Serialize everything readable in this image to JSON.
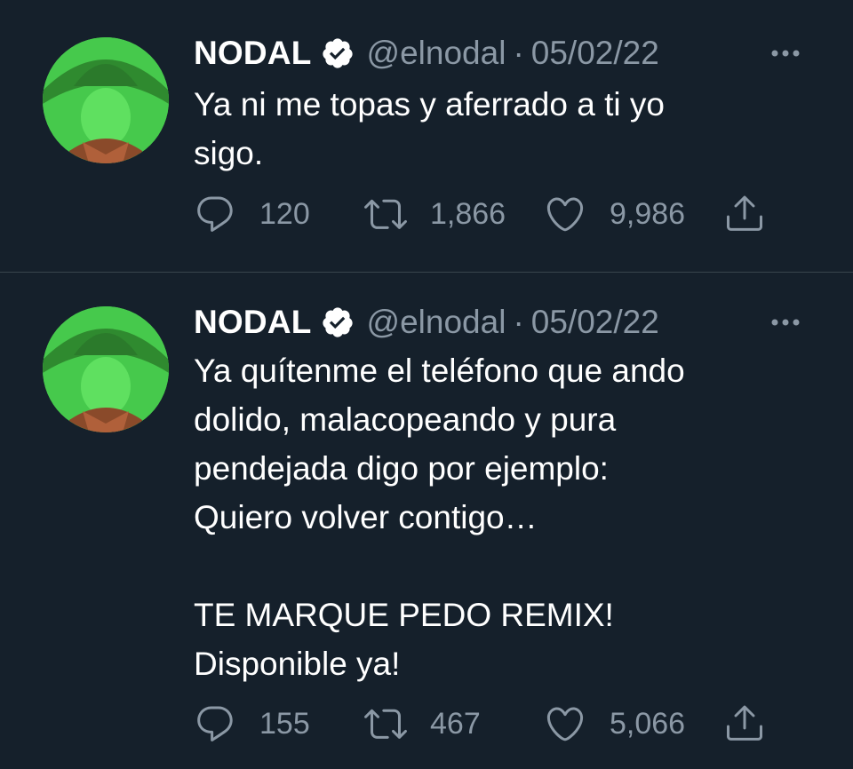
{
  "tweets": [
    {
      "name": "NODAL",
      "handle": "@elnodal",
      "separator": "·",
      "date": "05/02/22",
      "text": "Ya ni me topas y aferrado a ti yo\nsigo.",
      "replies": "120",
      "retweets": "1,866",
      "likes": "9,986"
    },
    {
      "name": "NODAL",
      "handle": "@elnodal",
      "separator": "·",
      "date": "05/02/22",
      "text": "Ya quítenme el teléfono que ando\ndolido, malacopeando y pura\npendejada digo por ejemplo:\nQuiero volver contigo…\n\nTE MARQUE PEDO REMIX!\nDisponible ya!",
      "replies": "155",
      "retweets": "467",
      "likes": "5,066"
    }
  ],
  "colors": {
    "background": "#15202b",
    "text": "#ffffff",
    "secondary": "#8b98a5",
    "divider": "#38444d",
    "avatar_tint": "#4cd152"
  },
  "icons": [
    "verified-badge-icon",
    "more-icon",
    "reply-icon",
    "retweet-icon",
    "like-icon",
    "share-icon"
  ]
}
